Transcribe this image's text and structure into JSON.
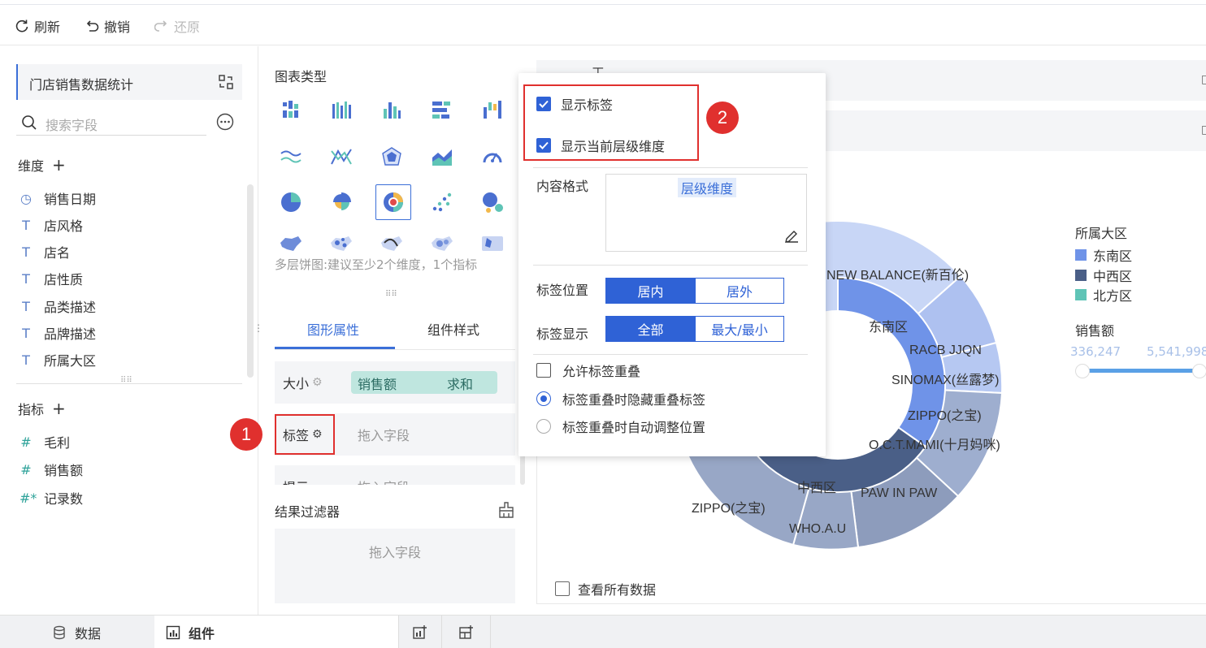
{
  "toolbar": {
    "refresh": "刷新",
    "undo": "撤销",
    "redo": "还原"
  },
  "left_panel": {
    "dataset_name": "门店销售数据统计",
    "search_placeholder": "搜索字段",
    "dimensions_title": "维度",
    "dimensions": [
      "销售日期",
      "店风格",
      "店名",
      "店性质",
      "品类描述",
      "品牌描述",
      "所属大区"
    ],
    "measures_title": "指标",
    "measures": [
      "毛利",
      "销售额",
      "记录数"
    ]
  },
  "middle_panel": {
    "chart_type_title": "图表类型",
    "chart_hint": "多层饼图:建议至少2个维度，1个指标",
    "tabs": [
      "图形属性",
      "组件样式"
    ],
    "props": {
      "size_label": "大小",
      "size_field": "销售额",
      "size_agg": "求和",
      "label_label": "标签",
      "label_drop": "拖入字段",
      "tooltip_label": "提示",
      "tooltip_drop": "拖入字段"
    },
    "filter_title": "结果过滤器",
    "filter_drop": "拖入字段"
  },
  "popup": {
    "show_label": "显示标签",
    "show_level_dim": "显示当前层级维度",
    "content_format_label": "内容格式",
    "content_format_value": "层级维度",
    "label_position_label": "标签位置",
    "label_position_options": [
      "居内",
      "居外"
    ],
    "label_position_selected": "居内",
    "label_display_label": "标签显示",
    "label_display_options": [
      "全部",
      "最大/最小"
    ],
    "label_display_selected": "全部",
    "allow_overlap": "允许标签重叠",
    "hide_overlap": "标签重叠时隐藏重叠标签",
    "auto_adjust": "标签重叠时自动调整位置",
    "show_label_checked": true,
    "show_level_dim_checked": true,
    "allow_overlap_checked": false,
    "overlap_mode": "hide"
  },
  "annotations": {
    "badge1": "1",
    "badge2": "2"
  },
  "chart": {
    "labels": [
      "NEW BALANCE(新百伦)",
      "东南区",
      "RACB JJQN",
      "SINOMAX(丝露梦)",
      "ZIPPO(之宝)",
      "O.C.T.MAMI(十月妈咪)",
      "PAW IN PAW",
      "中西区",
      "ZIPPO(之宝)",
      "WHO.A.U"
    ],
    "legend_title": "所属大区",
    "legend": [
      {
        "name": "东南区",
        "color": "#6f93e8"
      },
      {
        "name": "中西区",
        "color": "#4a5f87"
      },
      {
        "name": "北方区",
        "color": "#5fc4b6"
      }
    ],
    "size_title": "销售额",
    "size_min": "336,247",
    "size_max": "5,541,998",
    "view_all": "查看所有数据"
  },
  "bottom": {
    "data_tab": "数据",
    "component_tab": "组件"
  }
}
